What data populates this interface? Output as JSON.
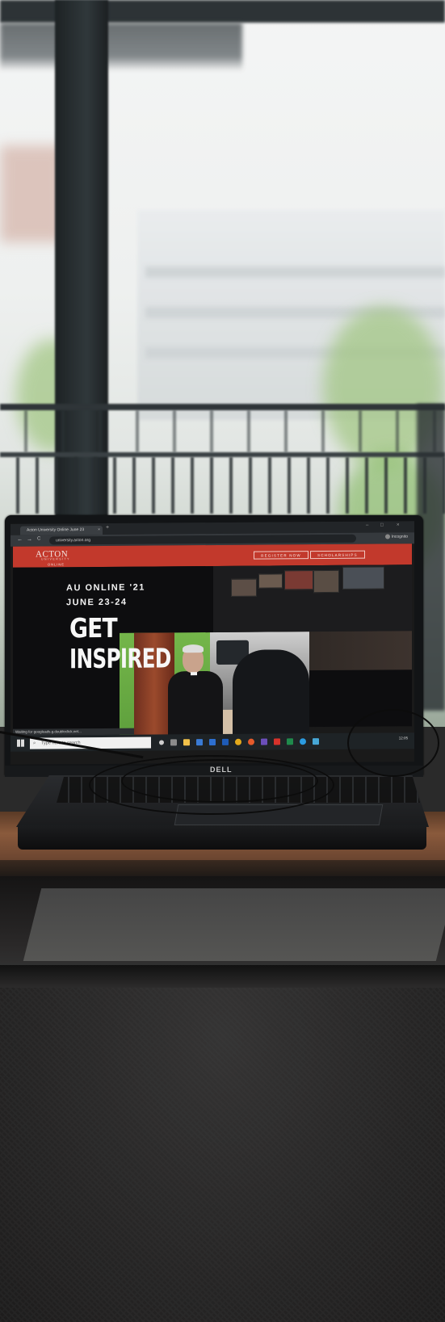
{
  "browser": {
    "tab_title": "Acton University Online June 23",
    "tab_close": "×",
    "new_tab": "+",
    "window_controls": [
      "–",
      "□",
      "×"
    ],
    "nav": [
      "←",
      "→",
      "C"
    ],
    "address": "university.acton.org",
    "profile_label": "Incognito"
  },
  "site": {
    "logo": "ACTON",
    "logo_sub": "UNIVERSITY",
    "logo_online": "ONLINE",
    "register_button": "REGISTER NOW",
    "scholarships_button": "SCHOLARSHIPS",
    "headline_1": "AU ONLINE '21",
    "headline_2": "JUNE 23-24",
    "tagline_1": "GET",
    "tagline_2": "INSPIRED"
  },
  "status_bar": "Waiting for googleads.g.doubleclick.net...",
  "taskbar": {
    "search_placeholder": "Type here to search",
    "search_glyph": "⌕",
    "tray_text": "12:05"
  },
  "hardware": {
    "brand": "DELL"
  },
  "colors": {
    "site_header_red": "#c2392c",
    "hero_background": "#0d0d0f",
    "green_screen": "#6aad44"
  }
}
